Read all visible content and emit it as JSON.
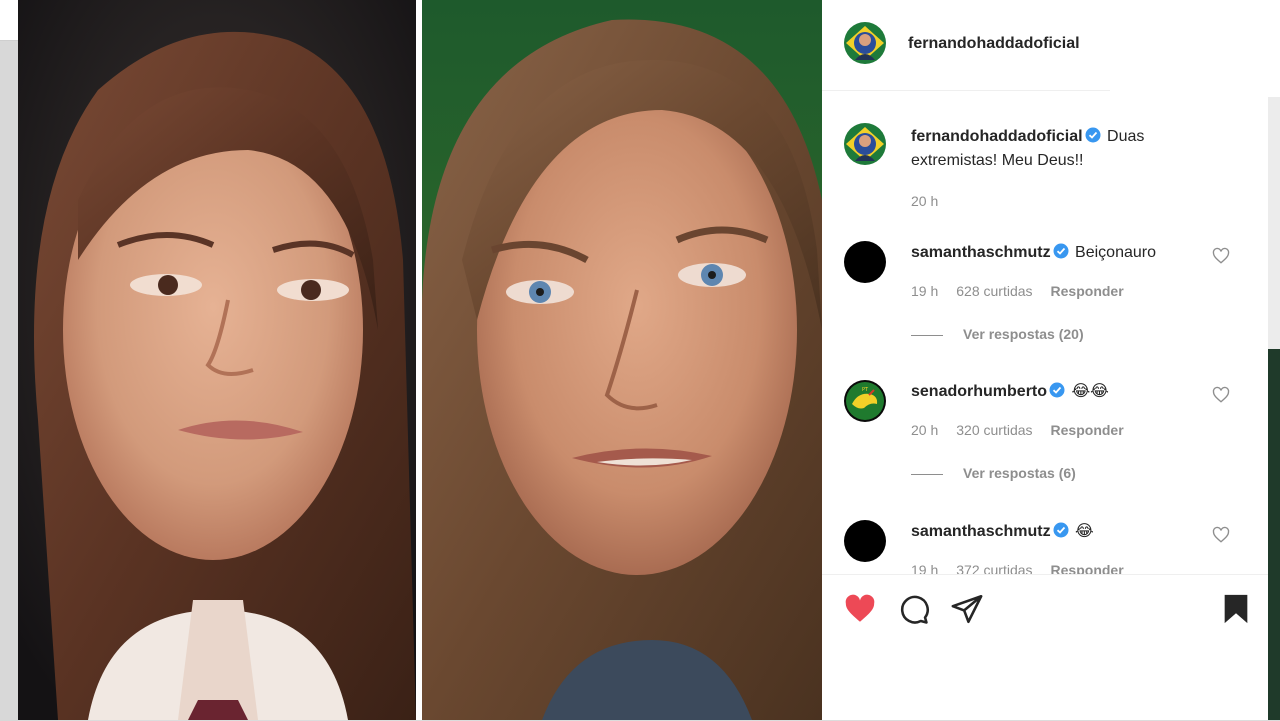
{
  "header": {
    "username": "fernandohaddadoficial"
  },
  "caption": {
    "username": "fernandohaddadoficial",
    "text": "Duas extremistas! Meu Deus!!",
    "time": "20 h"
  },
  "comments": [
    {
      "username": "samanthaschmutz",
      "text": "Beiçonauro",
      "time": "19 h",
      "likes": "628 curtidas",
      "reply_label": "Responder",
      "view_replies": "Ver respostas (20)"
    },
    {
      "username": "senadorhumberto",
      "text": "😂😂",
      "time": "20 h",
      "likes": "320 curtidas",
      "reply_label": "Responder",
      "view_replies": "Ver respostas (6)"
    },
    {
      "username": "samanthaschmutz",
      "text": "😂",
      "time": "19 h",
      "likes": "372 curtidas",
      "reply_label": "Responder"
    }
  ],
  "actions": {
    "like_icon": "heart-filled-icon",
    "comment_icon": "comment-bubble-icon",
    "share_icon": "paper-plane-icon",
    "save_icon": "bookmark-filled-icon"
  },
  "colors": {
    "like_red": "#ed4956",
    "text_primary": "#262626",
    "text_secondary": "#8e8e8e",
    "verified_blue": "#3897f0"
  }
}
